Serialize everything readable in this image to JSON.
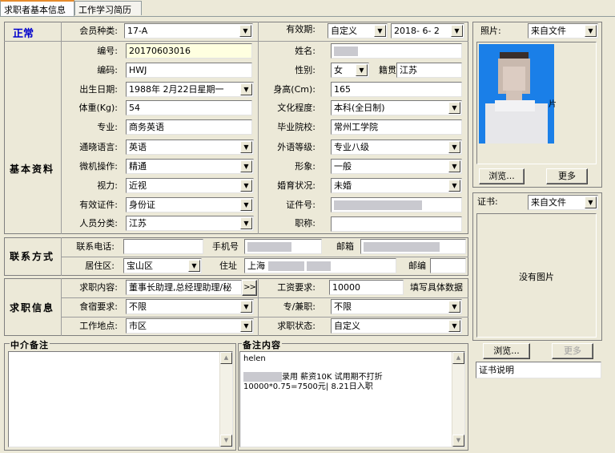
{
  "tabs": [
    "求职者基本信息",
    "工作学习简历"
  ],
  "status": "正常",
  "sections": {
    "basic": "基本资料",
    "contact": "联系方式",
    "job": "求职信息"
  },
  "fields": {
    "member_type": {
      "label": "会员种类:",
      "value": "17-A"
    },
    "validity": {
      "label": "有效期:",
      "value": "自定义",
      "date": "2018- 6- 2"
    },
    "number": {
      "label": "编号:",
      "value": "20170603016"
    },
    "name": {
      "label": "姓名:"
    },
    "code": {
      "label": "编码:",
      "value": "HWJ"
    },
    "gender": {
      "label": "性别:",
      "value": "女"
    },
    "origin": {
      "label": "籍贯",
      "value": "江苏"
    },
    "birth": {
      "label": "出生日期:",
      "value": "1988年 2月22日星期一"
    },
    "height": {
      "label": "身高(Cm):",
      "value": "165"
    },
    "weight": {
      "label": "体重(Kg):",
      "value": "54"
    },
    "education": {
      "label": "文化程度:",
      "value": "本科(全日制)"
    },
    "major": {
      "label": "专业:",
      "value": "商务英语"
    },
    "school": {
      "label": "毕业院校:",
      "value": "常州工学院"
    },
    "language": {
      "label": "通晓语言:",
      "value": "英语"
    },
    "foreign_level": {
      "label": "外语等级:",
      "value": "专业八级"
    },
    "computer": {
      "label": "微机操作:",
      "value": "精通"
    },
    "image": {
      "label": "形象:",
      "value": "一般"
    },
    "vision": {
      "label": "视力:",
      "value": "近视"
    },
    "marital": {
      "label": "婚育状况:",
      "value": "未婚"
    },
    "id_type": {
      "label": "有效证件:",
      "value": "身份证"
    },
    "id_no": {
      "label": "证件号:"
    },
    "category": {
      "label": "人员分类:",
      "value": "江苏"
    },
    "title": {
      "label": "职称:",
      "value": ""
    },
    "phone": {
      "label": "联系电话:",
      "value": ""
    },
    "mobile": {
      "label": "手机号"
    },
    "email": {
      "label": "邮箱"
    },
    "district": {
      "label": "居住区:",
      "value": "宝山区"
    },
    "address": {
      "label": "住址",
      "value": "上海"
    },
    "postcode": {
      "label": "邮编",
      "value": ""
    },
    "job_content": {
      "label": "求职内容:",
      "value": "董事长助理,总经理助理/秘"
    },
    "more_btn": ">>",
    "salary": {
      "label": "工资要求:",
      "value": "10000",
      "hint": "填写具体数据"
    },
    "board": {
      "label": "食宿要求:",
      "value": "不限"
    },
    "fulltime": {
      "label": "专/兼职:",
      "value": "不限"
    },
    "location": {
      "label": "工作地点:",
      "value": "市区"
    },
    "job_status": {
      "label": "求职状态:",
      "value": "自定义"
    }
  },
  "agency_note": {
    "title": "中介备注",
    "value": ""
  },
  "remark": {
    "title": "备注内容",
    "line1": "helen",
    "line2_suffix": "录用 薪资10K 试用期不打折",
    "line3": "10000*0.75=7500元| 8.21日入职"
  },
  "photo": {
    "label": "照片:",
    "source": "来自文件",
    "browse": "浏览...",
    "more": "更多"
  },
  "cert": {
    "label": "证书:",
    "source": "来自文件",
    "empty": "没有图片",
    "browse": "浏览...",
    "more": "更多",
    "desc": "证书说明"
  }
}
